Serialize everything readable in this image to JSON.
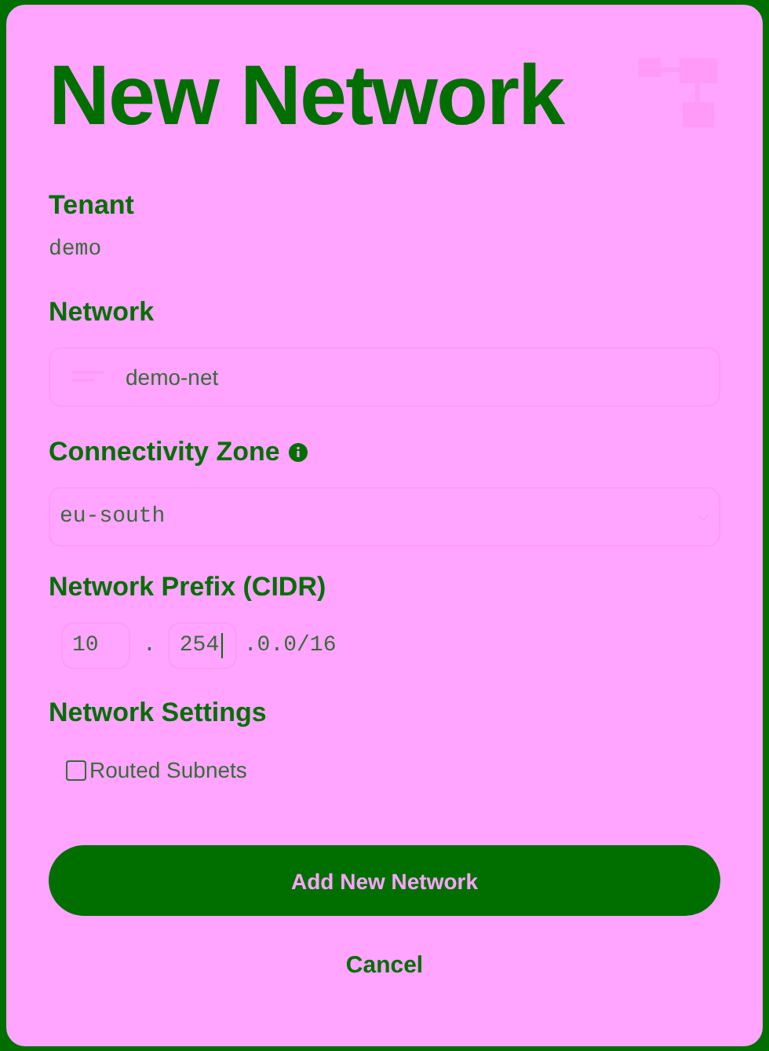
{
  "title": "New Network",
  "fields": [
    {
      "kind": "static",
      "label": "Tenant",
      "value": "demo"
    },
    {
      "kind": "text",
      "label": "Network",
      "value": "demo-net"
    },
    {
      "kind": "select",
      "label": "Connectivity Zone",
      "info": true,
      "value": "eu-south"
    },
    {
      "kind": "cidr",
      "label": "Network Prefix (CIDR)",
      "octets": [
        "10",
        "254"
      ],
      "separator": ".",
      "suffix": ".0.0/16"
    },
    {
      "kind": "checkboxes",
      "label": "Network Settings",
      "options": [
        {
          "label": "Routed Subnets",
          "checked": false
        }
      ]
    }
  ],
  "primary_button": "Add New Network",
  "cancel": "Cancel"
}
